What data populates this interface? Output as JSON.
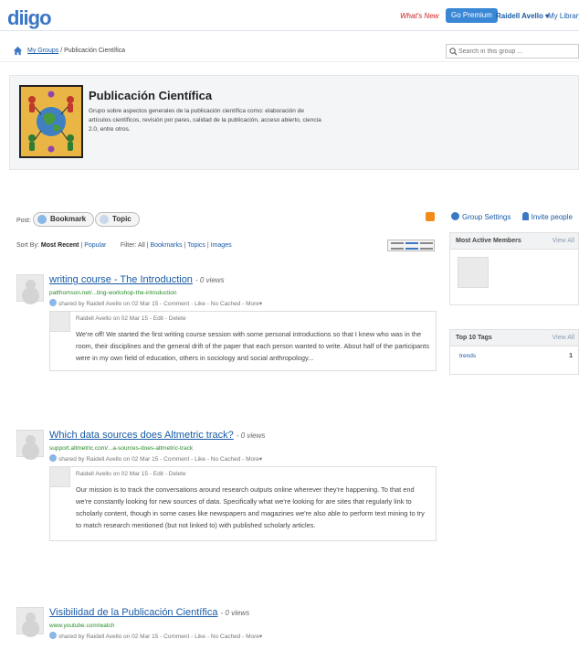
{
  "topbar": {
    "logo": "diigo",
    "whats_new": "What's New",
    "premium": "Go Premium",
    "user": "Raidell Avello ▾",
    "library": "My Library"
  },
  "breadcrumb": {
    "groups": "My Groups",
    "sep": "/",
    "current": "Publicación Científica",
    "search_placeholder": "Search in this group ..."
  },
  "group": {
    "title": "Publicación Científica",
    "description": "Grupo sobre aspectos generales de la publicación científica como: elaboración de artículos científicos, revisión por pares, calidad de la publicación, acceso abierto, ciencia 2.0, entre otros."
  },
  "post": {
    "label": "Post:",
    "bookmark": "Bookmark",
    "topic": "Topic"
  },
  "sort": {
    "label": "Sort By:",
    "most_recent": "Most Recent",
    "popular": "Popular",
    "filter_label": "Filter:",
    "all": "All",
    "bookmarks": "Bookmarks",
    "topics": "Topics",
    "images": "Images"
  },
  "items": [
    {
      "title": "writing course - The Introduction",
      "views": "- 0 views",
      "url": "patthomson.net/...ting-workshop-the-introduction",
      "meta": "shared by Raidell Avello on 02 Mar 15  - Comment - Like - No Cached - More▾",
      "ann_head": "Raidell Avello on 02 Mar 15  - Edit - Delete",
      "ann_text": "We're off! We started the first writing course session with some personal introductions so that I knew who was in the room, their disciplines and the general drift of the paper that each person wanted to write. About half of the participants were in my own field of education, others in sociology and social anthropology..."
    },
    {
      "title": "Which data sources does Altmetric track?",
      "views": "- 0 views",
      "url": "support.altmetric.com/...a-sources-does-altmetric-track",
      "meta": "shared by Raidell Avello on 02 Mar 15  - Comment - Like - No Cached - More▾",
      "ann_head": "Raidell Avello on 02 Mar 15  - Edit - Delete",
      "ann_text": "Our mission is to track the conversations around research outputs online wherever they're happening. To that end we're constantly looking for new sources of data. Specifically what we're looking for are sites that regularly link to scholarly content, though in some cases like newspapers and magazines we're also able to perform text mining to try to match research mentioned (but not linked to) with published scholarly articles."
    },
    {
      "title": "Visibilidad de la Publicación Científica",
      "views": "- 0 views",
      "url": "www.youtube.com/watch",
      "meta": "shared by Raidell Avello on 02 Mar 15  - Comment - Like - No Cached - More▾"
    }
  ],
  "sidebar": {
    "group_settings": "Group Settings",
    "invite": "Invite people",
    "active_members": "Most Active Members",
    "top_tags": "Top 10 Tags",
    "view_all": "View All",
    "tag_name": "trends",
    "tag_count": "1"
  },
  "colors": {
    "brand": "#3b77c5",
    "link": "#1a5ba6",
    "url_green": "#2a8a2a",
    "whats_new_red": "#cc2222"
  }
}
